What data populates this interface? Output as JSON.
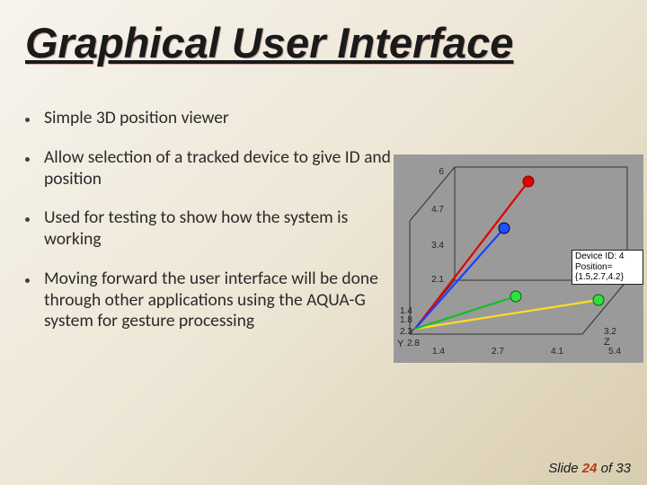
{
  "title": "Graphical User Interface",
  "bullets": [
    "Simple 3D position viewer",
    "Allow selection of a tracked device to give ID and position",
    "Used for testing to show how the system is working",
    "Moving forward the user interface will be done through other applications using the AQUA-G system for gesture processing"
  ],
  "figure": {
    "label_line1": "Device ID: 4",
    "label_line2": "Position={1.5,2.7,4.2}",
    "axis_z_ticks": [
      "6",
      "4.7",
      "3.4",
      "2.1"
    ],
    "axis_y_ticks": [
      "1.4",
      "1.8",
      "2.3",
      "2.8",
      "Y"
    ],
    "axis_x_ticks": [
      "1.4",
      "2.7",
      "4.1",
      "5.4"
    ],
    "axis_x_top": [
      "3.2",
      "Z"
    ]
  },
  "footer": {
    "prefix": "Slide ",
    "current": "24",
    "mid": " of ",
    "total": "33"
  }
}
